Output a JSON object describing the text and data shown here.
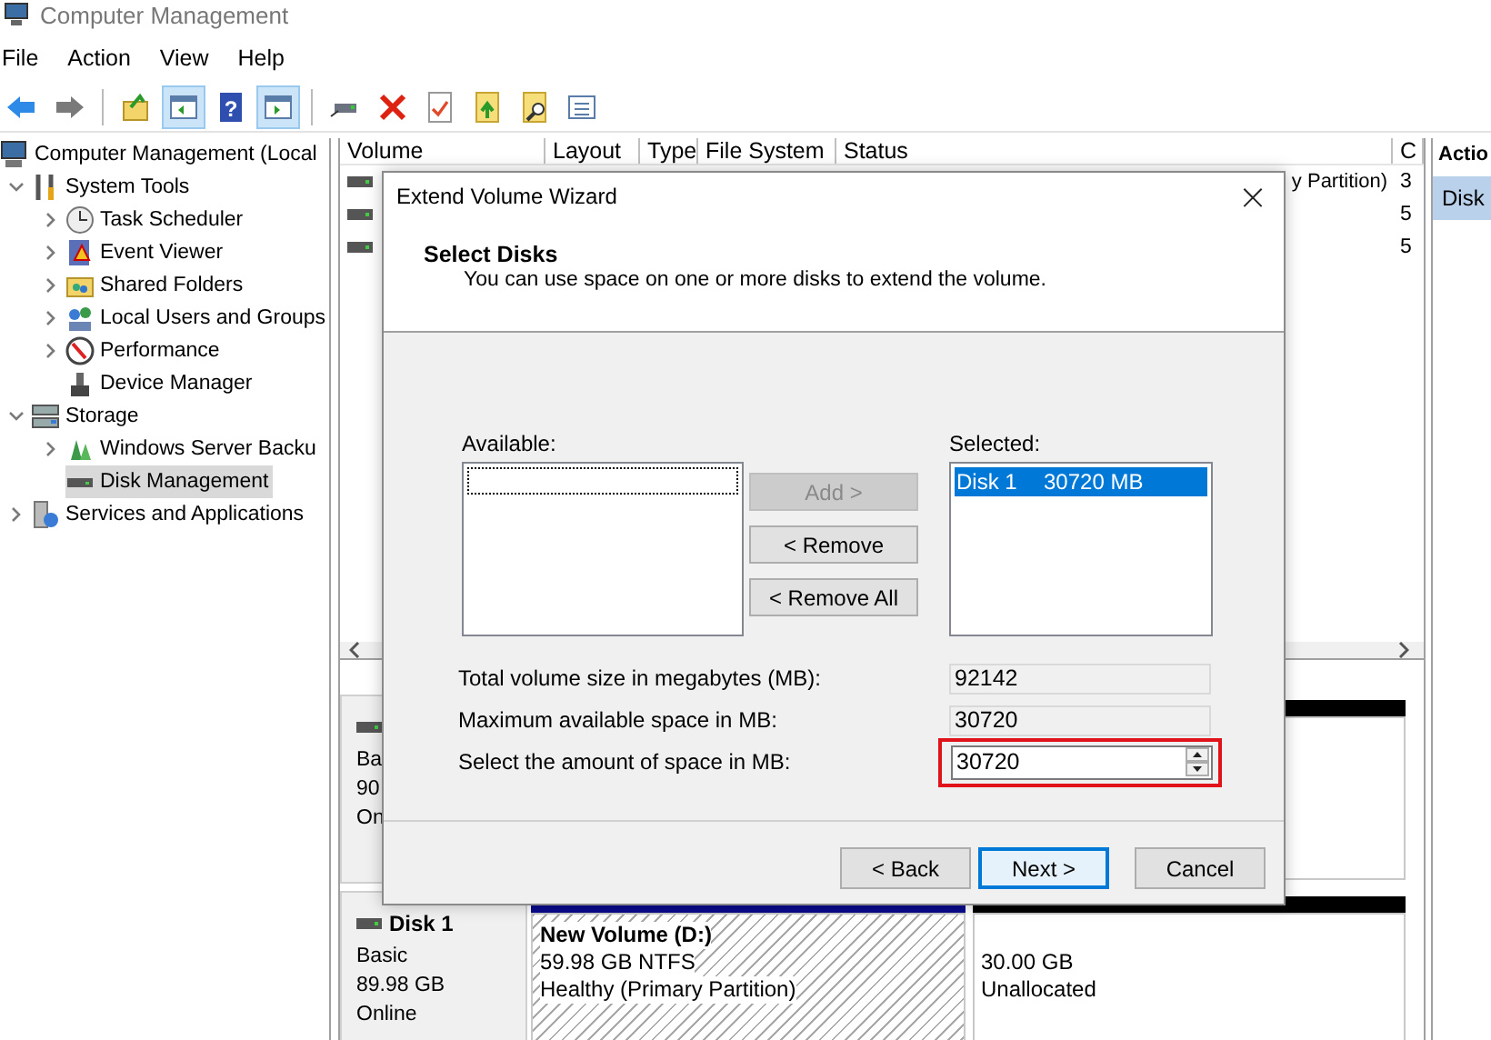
{
  "window": {
    "title": "Computer Management"
  },
  "menu": [
    "File",
    "Action",
    "View",
    "Help"
  ],
  "toolbar": {
    "buttons": [
      {
        "pressed": false
      },
      {
        "pressed": false
      },
      {
        "pressed": false
      },
      {
        "pressed": true
      },
      {
        "pressed": false,
        "glyph": "?"
      },
      {
        "pressed": true
      },
      {
        "pressed": false
      },
      {
        "pressed": false
      },
      {
        "pressed": false
      },
      {
        "pressed": false
      },
      {
        "pressed": false
      },
      {
        "pressed": false
      }
    ]
  },
  "tree": {
    "items": [
      {
        "label": "Computer Management (Local",
        "selected": false,
        "children": [
          {
            "label": "System Tools",
            "expanded": true,
            "selected": false,
            "children": [
              {
                "label": "Task Scheduler",
                "expanded": false,
                "selected": false
              },
              {
                "label": "Event Viewer",
                "expanded": false,
                "selected": false
              },
              {
                "label": "Shared Folders",
                "expanded": false,
                "selected": false
              },
              {
                "label": "Local Users and Groups",
                "expanded": false,
                "selected": false
              },
              {
                "label": "Performance",
                "expanded": false,
                "selected": false
              },
              {
                "label": "Device Manager",
                "selected": false
              }
            ]
          },
          {
            "label": "Storage",
            "expanded": true,
            "selected": false,
            "children": [
              {
                "label": "Windows Server Backu",
                "expanded": false,
                "selected": false
              },
              {
                "label": "Disk Management",
                "selected": true
              }
            ]
          },
          {
            "label": "Services and Applications",
            "expanded": false,
            "selected": false
          }
        ]
      }
    ]
  },
  "volume_list": {
    "columns": [
      "Volume",
      "Layout",
      "Type",
      "File System",
      "Status",
      "C"
    ],
    "rows": [
      {
        "status": "y Partition)",
        "capacity": "3"
      },
      {
        "capacity": "5"
      },
      {
        "capacity": "5"
      }
    ]
  },
  "action_pane": {
    "title": "Actio",
    "items": [
      {
        "label": "Disk",
        "selected": true
      }
    ]
  },
  "disks": [
    {
      "type": "Ba",
      "size": "90",
      "status": "On",
      "partitions": [
        {
          "kind": "unallocated"
        }
      ]
    },
    {
      "name": "Disk 1",
      "type": "Basic",
      "size": "89.98 GB",
      "status": "Online",
      "partitions": [
        {
          "kind": "primary",
          "name": "New Volume  (D:)",
          "size": "59.98 GB NTFS",
          "status": "Healthy (Primary Partition)"
        },
        {
          "kind": "unallocated",
          "size": "30.00 GB",
          "status": "Unallocated"
        }
      ]
    }
  ],
  "dialog": {
    "title": "Extend Volume Wizard",
    "close": "×",
    "heading": "Select Disks",
    "subheading": "You can use space on one or more disks to extend the volume.",
    "available_label": "Available:",
    "selected_label": "Selected:",
    "selected_items": [
      {
        "disk": "Disk 1",
        "size": "30720 MB",
        "selected": true
      }
    ],
    "move_buttons": [
      {
        "label": "Add >",
        "disabled": true
      },
      {
        "label": "< Remove",
        "disabled": false
      },
      {
        "label": "< Remove All",
        "disabled": false
      }
    ],
    "fields": [
      {
        "kind": "readonly",
        "label": "Total volume size in megabytes (MB):",
        "value": "92142"
      },
      {
        "kind": "readonly",
        "label": "Maximum available space in MB:",
        "value": "30720"
      },
      {
        "kind": "spin",
        "label": "Select the amount of space in MB:",
        "value": "30720",
        "highlighted": true
      }
    ],
    "buttons": [
      {
        "label": "< Back",
        "focused": false
      },
      {
        "label": "Next >",
        "focused": true
      },
      {
        "label": "Cancel",
        "focused": false
      }
    ]
  }
}
